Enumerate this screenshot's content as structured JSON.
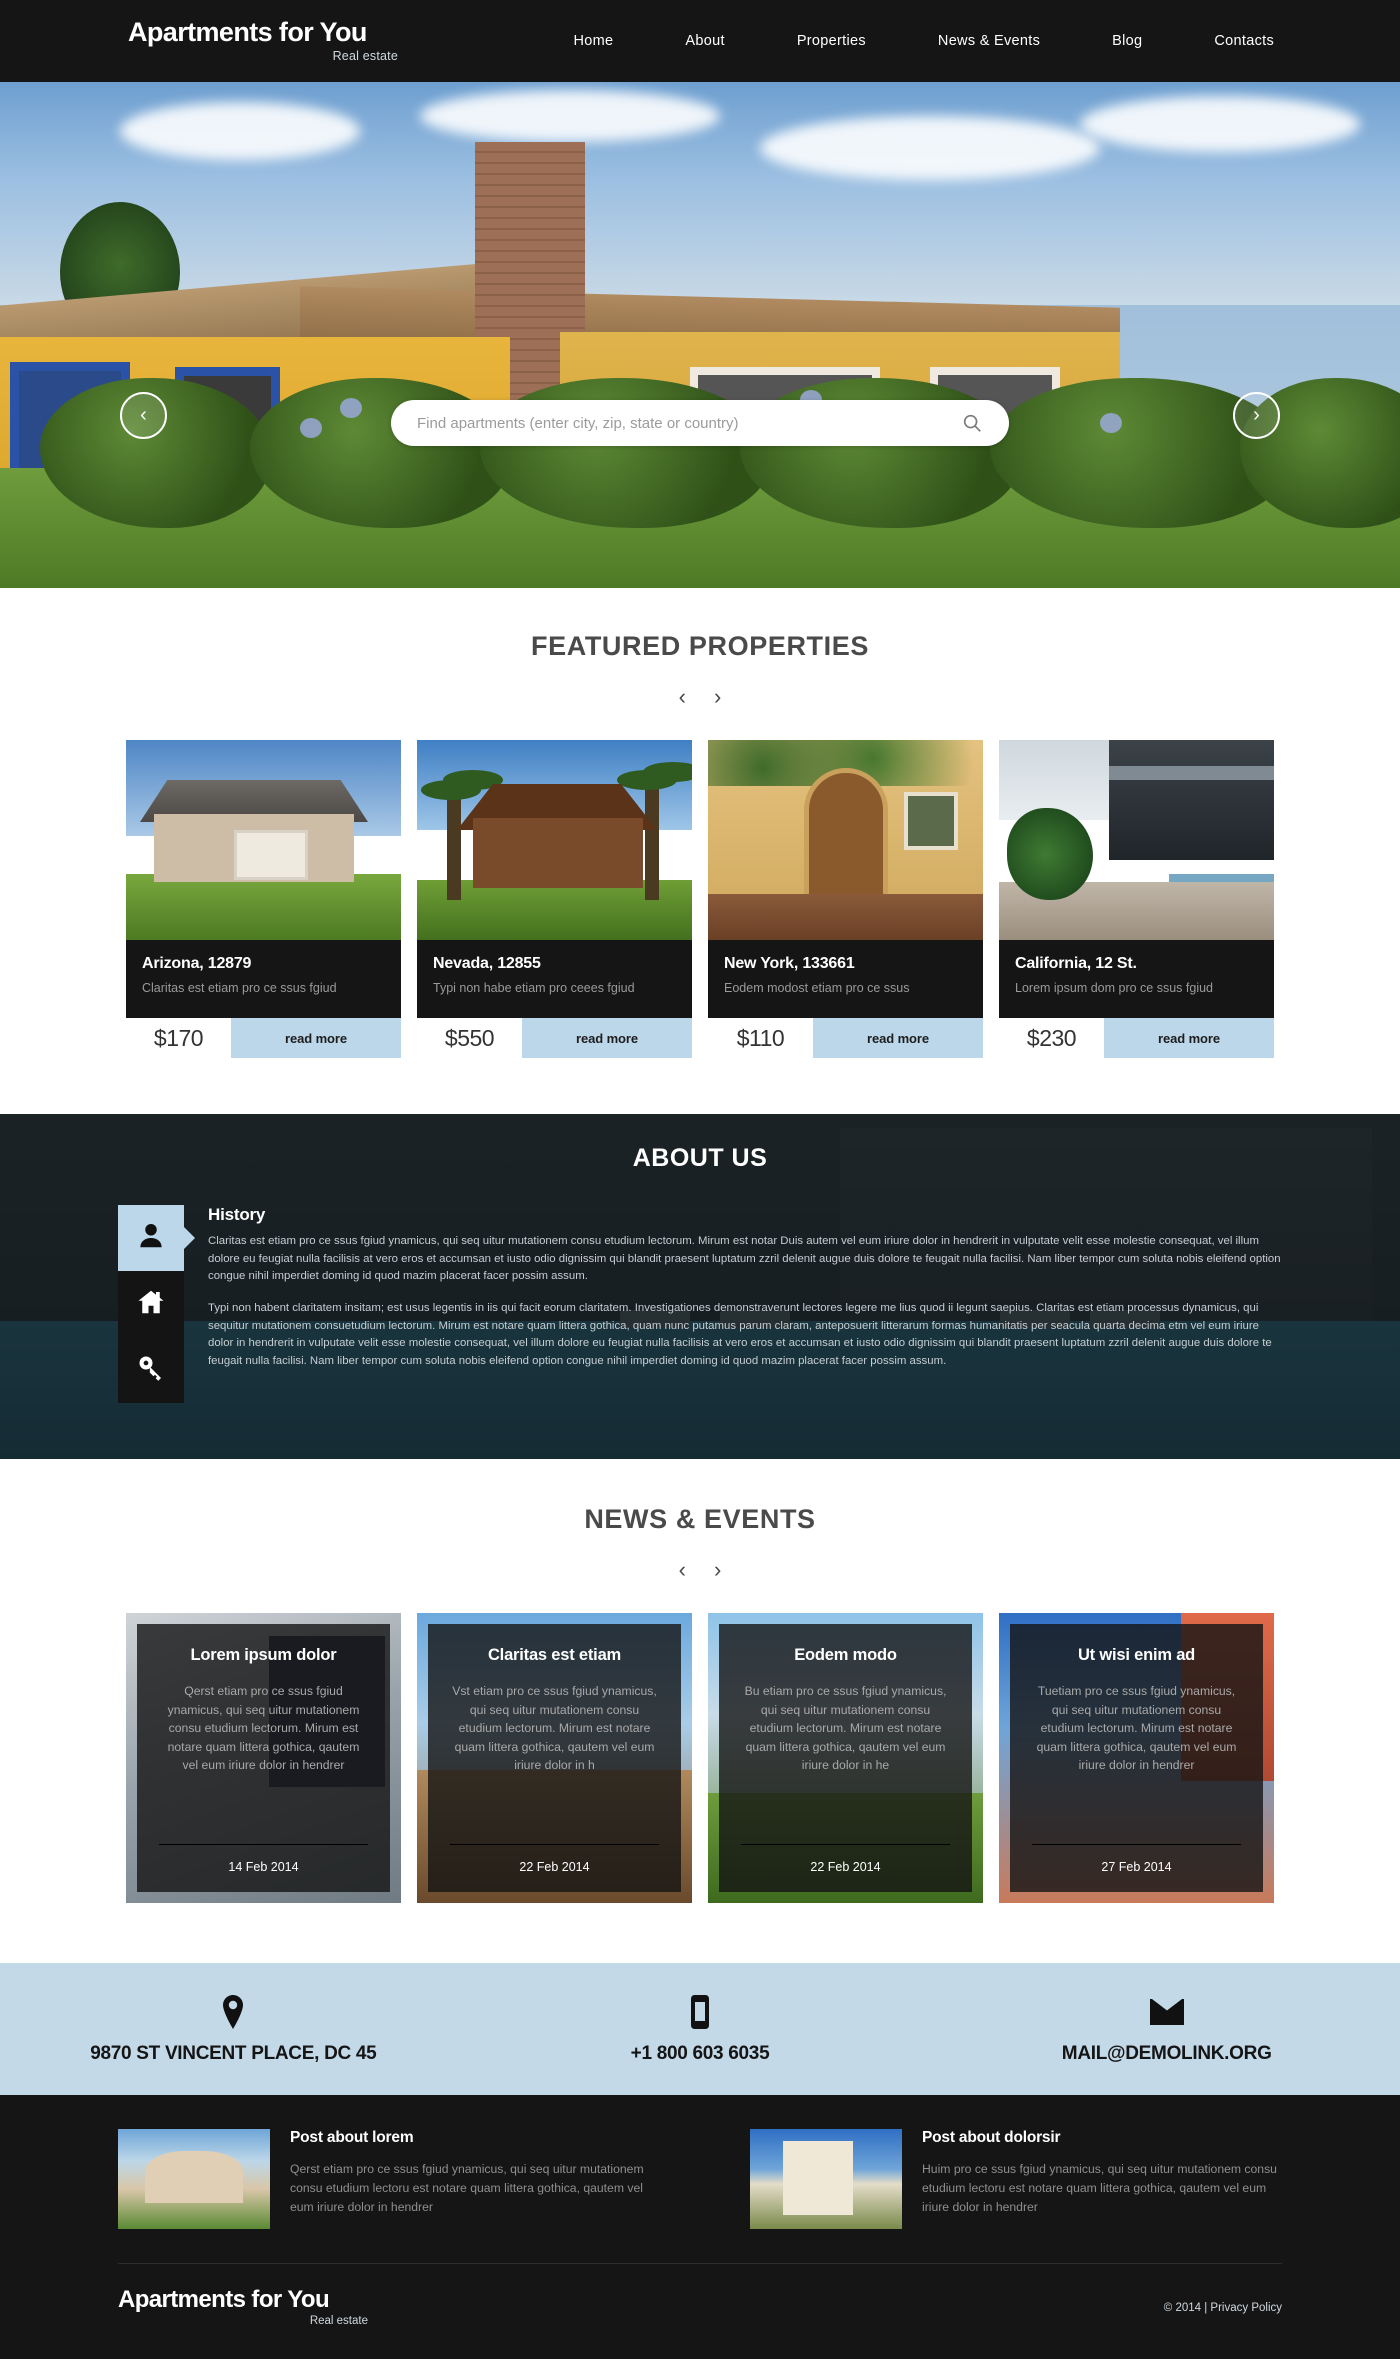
{
  "header": {
    "logo_title": "Apartments for You",
    "logo_sub": "Real estate",
    "nav": [
      {
        "label": "Home"
      },
      {
        "label": "About"
      },
      {
        "label": "Properties"
      },
      {
        "label": "News & Events"
      },
      {
        "label": "Blog"
      },
      {
        "label": "Contacts"
      }
    ]
  },
  "hero": {
    "search_placeholder": "Find apartments (enter city, zip, state or country)",
    "search_value": "",
    "prev_label": "‹",
    "next_label": "›"
  },
  "featured": {
    "title": "FEATURED PROPERTIES",
    "prev_label": "‹",
    "next_label": "›",
    "cards": [
      {
        "title": "Arizona, 12879",
        "desc": "Claritas est etiam pro ce ssus  fgiud",
        "price": "$170",
        "read_more": "read more"
      },
      {
        "title": "Nevada, 12855",
        "desc": "Typi non habe etiam pro ceees  fgiud",
        "price": "$550",
        "read_more": "read more"
      },
      {
        "title": "New York, 133661",
        "desc": "Eodem modost etiam pro ce ssus",
        "price": "$110",
        "read_more": "read more"
      },
      {
        "title": "California, 12 St.",
        "desc": "Lorem ipsum dom pro ce ssus  fgiud",
        "price": "$230",
        "read_more": "read more"
      }
    ]
  },
  "about": {
    "title": "ABOUT US",
    "icons": [
      {
        "name": "person-icon",
        "active": true
      },
      {
        "name": "home-icon",
        "active": false
      },
      {
        "name": "key-icon",
        "active": false
      }
    ],
    "heading": "History",
    "paragraph1": "Claritas est etiam pro ce ssus  fgiud ynamicus, qui seq uitur mutationem consu etudium lectorum. Mirum est notar Duis autem vel eum iriure dolor in hendrerit in vulputate velit esse molestie consequat, vel illum dolore eu feugiat nulla facilisis at vero eros et accumsan et iusto odio dignissim qui blandit praesent luptatum zzril delenit augue duis dolore te feugait nulla facilisi. Nam liber tempor cum soluta nobis eleifend option congue nihil imperdiet doming id quod mazim placerat facer possim assum.",
    "paragraph2": "Typi non habent claritatem insitam; est usus legentis in iis qui facit eorum claritatem. Investigationes demonstraverunt lectores legere me lius quod ii legunt saepius. Claritas est etiam processus dynamicus, qui sequitur mutationem consuetudium lectorum. Mirum est notare quam littera gothica, quam nunc putamus parum claram, anteposuerit litterarum formas humanitatis per seacula quarta decima etm vel eum iriure dolor in hendrerit in vulputate velit esse molestie consequat, vel illum dolore eu feugiat nulla facilisis at vero eros et accumsan et iusto odio dignissim qui blandit praesent luptatum zzril delenit augue duis dolore te feugait nulla facilisi. Nam liber tempor cum soluta nobis eleifend option congue nihil imperdiet doming id quod mazim placerat facer possim assum."
  },
  "news": {
    "title": "NEWS & EVENTS",
    "prev_label": "‹",
    "next_label": "›",
    "cards": [
      {
        "title": "Lorem ipsum dolor",
        "text": "Qerst etiam pro ce ssus  fgiud ynamicus, qui seq uitur mutationem consu etudium lectorum. Mirum est notare quam littera gothica, qautem vel eum iriure dolor in hendrer",
        "date": "14 Feb 2014"
      },
      {
        "title": "Claritas est etiam",
        "text": "Vst etiam pro ce ssus  fgiud ynamicus, qui seq uitur mutationem consu etudium lectorum. Mirum est notare quam littera gothica, qautem vel eum iriure dolor in h",
        "date": "22 Feb 2014"
      },
      {
        "title": "Eodem modo",
        "text": "Bu etiam pro ce ssus  fgiud ynamicus, qui seq uitur mutationem consu etudium lectorum. Mirum est notare quam littera gothica, qautem vel eum iriure dolor in he",
        "date": "22 Feb 2014"
      },
      {
        "title": "Ut wisi enim ad",
        "text": "Tuetiam pro ce ssus  fgiud ynamicus, qui seq uitur mutationem consu etudium lectorum. Mirum est notare quam littera gothica, qautem vel eum iriure dolor in hendrer",
        "date": "27 Feb 2014"
      }
    ]
  },
  "contact": {
    "address": "9870 ST VINCENT PLACE, DC 45",
    "phone": "+1 800 603 6035",
    "email": "MAIL@DEMOLINK.ORG"
  },
  "footer": {
    "posts": [
      {
        "title": "Post about lorem",
        "text": "Qerst etiam pro ce ssus  fgiud ynamicus, qui seq uitur mutationem consu etudium lectoru est notare quam littera gothica, qautem vel eum iriure dolor in hendrer"
      },
      {
        "title": "Post about  dolorsir",
        "text": "Huim pro ce ssus  fgiud ynamicus, qui seq uitur mutationem consu etudium lectoru est notare quam littera gothica, qautem vel eum iriure dolor in hendrer"
      }
    ],
    "logo_title": "Apartments for You",
    "logo_sub": "Real estate",
    "copyright": "© 2014 | Privacy Policy"
  },
  "colors": {
    "dark": "#151515",
    "accent": "#bdd7ea",
    "contact_bar": "#c3d9e8",
    "muted_text": "#9a9a9a"
  }
}
